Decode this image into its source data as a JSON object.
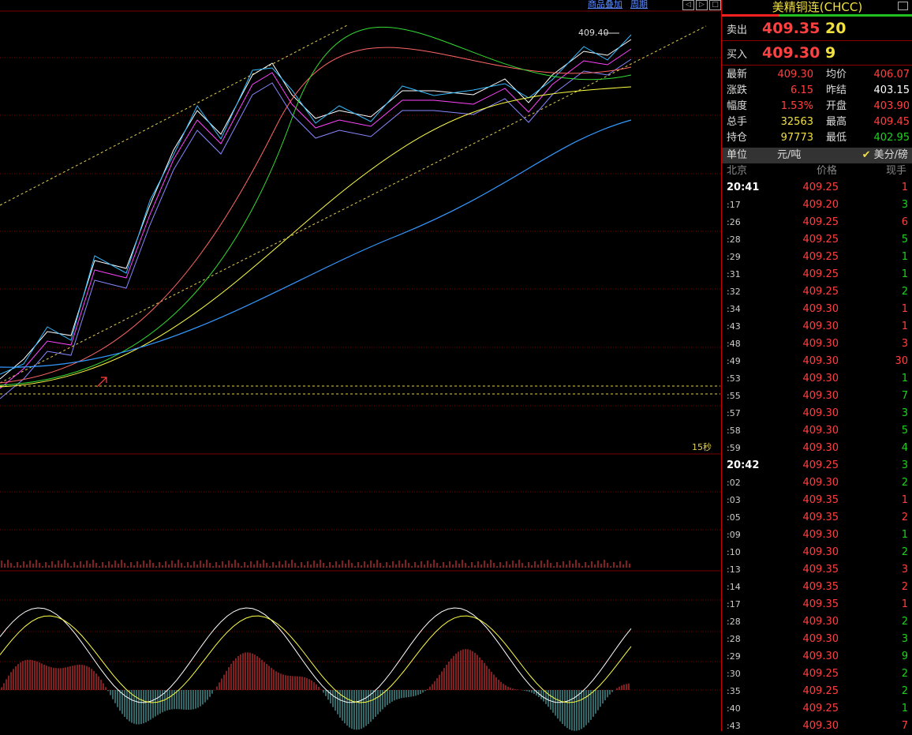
{
  "toolbar": {
    "overlay_label": "商品叠加",
    "period_label": "周期"
  },
  "chart": {
    "peak_price_label": "409.40",
    "period_indicator": "15秒"
  },
  "panel": {
    "title": "美精铜连(CHCC)",
    "ask": {
      "label": "卖出",
      "price": "409.35",
      "volume": "20"
    },
    "bid": {
      "label": "买入",
      "price": "409.30",
      "volume": "9"
    },
    "stats": [
      {
        "k1": "最新",
        "v1": "409.30",
        "c1": "red",
        "k2": "均价",
        "v2": "406.07",
        "c2": "red"
      },
      {
        "k1": "涨跌",
        "v1": "6.15",
        "c1": "red",
        "k2": "昨结",
        "v2": "403.15",
        "c2": "white"
      },
      {
        "k1": "幅度",
        "v1": "1.53%",
        "c1": "red",
        "k2": "开盘",
        "v2": "403.90",
        "c2": "red"
      },
      {
        "k1": "总手",
        "v1": "32563",
        "c1": "yellow",
        "k2": "最高",
        "v2": "409.45",
        "c2": "red"
      },
      {
        "k1": "持仓",
        "v1": "97773",
        "c1": "yellow",
        "k2": "最低",
        "v2": "402.95",
        "c2": "green"
      }
    ],
    "unit": {
      "label": "单位",
      "value": "元/吨",
      "check": "✔",
      "alt": "美分/磅"
    },
    "tick_header": {
      "time": "北京",
      "price": "价格",
      "qty": "现手"
    },
    "ticks": [
      {
        "time": "20:41",
        "full": true,
        "price": "409.25",
        "qty": "1",
        "c": "red"
      },
      {
        "time": ":17",
        "price": "409.20",
        "qty": "3",
        "c": "green"
      },
      {
        "time": ":26",
        "price": "409.25",
        "qty": "6",
        "c": "red"
      },
      {
        "time": ":28",
        "price": "409.25",
        "qty": "5",
        "c": "green"
      },
      {
        "time": ":29",
        "price": "409.25",
        "qty": "1",
        "c": "green"
      },
      {
        "time": ":31",
        "price": "409.25",
        "qty": "1",
        "c": "green"
      },
      {
        "time": ":32",
        "price": "409.25",
        "qty": "2",
        "c": "green"
      },
      {
        "time": ":34",
        "price": "409.30",
        "qty": "1",
        "c": "red"
      },
      {
        "time": ":43",
        "price": "409.30",
        "qty": "1",
        "c": "red"
      },
      {
        "time": ":48",
        "price": "409.30",
        "qty": "3",
        "c": "red"
      },
      {
        "time": ":49",
        "price": "409.30",
        "qty": "30",
        "c": "red"
      },
      {
        "time": ":53",
        "price": "409.30",
        "qty": "1",
        "c": "green"
      },
      {
        "time": ":55",
        "price": "409.30",
        "qty": "7",
        "c": "green"
      },
      {
        "time": ":57",
        "price": "409.30",
        "qty": "3",
        "c": "green"
      },
      {
        "time": ":58",
        "price": "409.30",
        "qty": "5",
        "c": "green"
      },
      {
        "time": ":59",
        "price": "409.30",
        "qty": "4",
        "c": "green"
      },
      {
        "time": "20:42",
        "full": true,
        "price": "409.25",
        "qty": "3",
        "c": "green"
      },
      {
        "time": ":02",
        "price": "409.30",
        "qty": "2",
        "c": "green"
      },
      {
        "time": ":03",
        "price": "409.35",
        "qty": "1",
        "c": "red"
      },
      {
        "time": ":05",
        "price": "409.35",
        "qty": "2",
        "c": "red"
      },
      {
        "time": ":09",
        "price": "409.30",
        "qty": "1",
        "c": "green"
      },
      {
        "time": ":10",
        "price": "409.30",
        "qty": "2",
        "c": "green"
      },
      {
        "time": ":13",
        "price": "409.35",
        "qty": "3",
        "c": "red"
      },
      {
        "time": ":14",
        "price": "409.35",
        "qty": "2",
        "c": "red"
      },
      {
        "time": ":17",
        "price": "409.35",
        "qty": "1",
        "c": "red"
      },
      {
        "time": ":28",
        "price": "409.30",
        "qty": "2",
        "c": "green"
      },
      {
        "time": ":28",
        "price": "409.30",
        "qty": "3",
        "c": "green"
      },
      {
        "time": ":29",
        "price": "409.30",
        "qty": "9",
        "c": "green"
      },
      {
        "time": ":30",
        "price": "409.25",
        "qty": "2",
        "c": "green"
      },
      {
        "time": ":35",
        "price": "409.25",
        "qty": "2",
        "c": "green"
      },
      {
        "time": ":40",
        "price": "409.25",
        "qty": "1",
        "c": "green"
      },
      {
        "time": ":43",
        "price": "409.30",
        "qty": "7",
        "c": "red"
      }
    ]
  },
  "colors": {
    "up": "#ff4040",
    "down": "#20d020",
    "grid": "#7a0000",
    "accent": "#f0e040"
  }
}
